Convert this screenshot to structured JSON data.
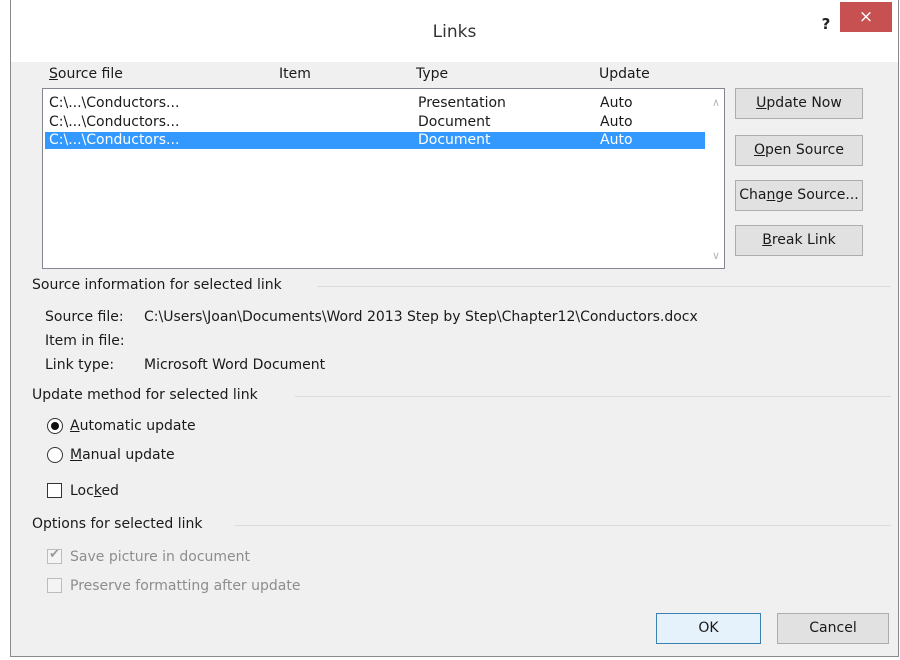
{
  "dialog": {
    "title": "Links",
    "help_label": "?",
    "close_label": "×"
  },
  "links_table": {
    "columns": {
      "source_pre": "",
      "source_u": "S",
      "source_rest": "ource file",
      "item": "Item",
      "type": "Type",
      "update": "Update"
    },
    "rows": [
      {
        "source": "C:\\...\\Conductors...",
        "item": "",
        "type": "Presentation",
        "update": "Auto",
        "selected": false
      },
      {
        "source": "C:\\...\\Conductors...",
        "item": "",
        "type": "Document",
        "update": "Auto",
        "selected": false
      },
      {
        "source": "C:\\...\\Conductors...",
        "item": "",
        "type": "Document",
        "update": "Auto",
        "selected": true
      }
    ],
    "scroll_up": "∧",
    "scroll_down": "∨"
  },
  "buttons": {
    "update_now": {
      "u": "U",
      "rest": "pdate Now"
    },
    "open_source": {
      "u": "O",
      "rest": "pen Source"
    },
    "change_source": {
      "pre": "Cha",
      "u": "n",
      "rest": "ge Source..."
    },
    "break_link": {
      "u": "B",
      "rest": "reak Link"
    },
    "ok": "OK",
    "cancel": "Cancel"
  },
  "source_info": {
    "heading": "Source information for selected link",
    "source_file_label": "Source file:",
    "source_file_value": "C:\\Users\\Joan\\Documents\\Word 2013 Step by Step\\Chapter12\\Conductors.docx",
    "item_label": "Item in file:",
    "item_value": "",
    "link_type_label": "Link type:",
    "link_type_value": "Microsoft Word Document"
  },
  "update_method": {
    "heading": "Update method for selected link",
    "automatic": {
      "u": "A",
      "rest": "utomatic update",
      "checked": true
    },
    "manual": {
      "u": "M",
      "rest": "anual update",
      "checked": false
    },
    "locked": {
      "pre": "Loc",
      "u": "k",
      "rest": "ed",
      "checked": false
    }
  },
  "options": {
    "heading": "Options for selected link",
    "save_picture": {
      "label": "Save picture in document",
      "checked": true,
      "enabled": false
    },
    "preserve_formatting": {
      "label": "Preserve formatting after update",
      "checked": false,
      "enabled": false
    }
  }
}
